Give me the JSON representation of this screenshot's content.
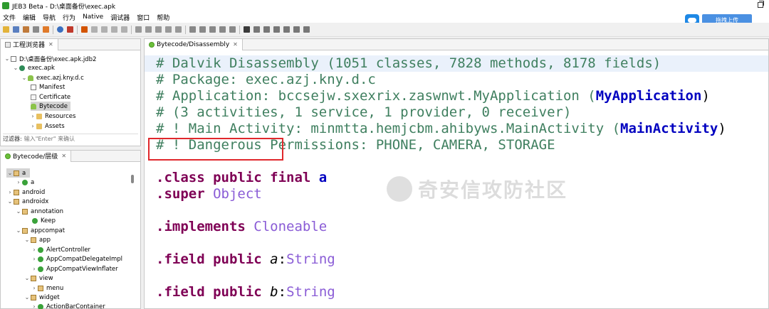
{
  "window": {
    "title": "JEB3 Beta - D:\\桌面备份\\exec.apk"
  },
  "menu": [
    "文件",
    "编辑",
    "导航",
    "行为",
    "Native",
    "调试器",
    "窗口",
    "帮助"
  ],
  "cloud": {
    "button_label": "拖拽上传",
    "icon": "baidu-cloud-icon",
    "accent": "#4a90e2"
  },
  "project_panel": {
    "tab_label": "工程浏览器",
    "tree": [
      {
        "label": "D:\\桌面备份\\exec.apk.jdb2",
        "icon": "database-icon"
      },
      {
        "label": "exec.apk",
        "icon": "apk-icon"
      },
      {
        "label": "exec.azj.kny.d.c",
        "icon": "android-icon"
      },
      {
        "label": "Manifest",
        "icon": "file-icon"
      },
      {
        "label": "Certificate",
        "icon": "certificate-icon"
      },
      {
        "label": "Bytecode",
        "icon": "bytecode-icon"
      },
      {
        "label": "Resources",
        "icon": "folder-icon"
      },
      {
        "label": "Assets",
        "icon": "folder-icon"
      }
    ],
    "filter_label": "过滤器:",
    "filter_placeholder": "输入\"Enter\" 来确认"
  },
  "hierarchy_panel": {
    "tab_label": "Bytecode/层级",
    "tree": [
      {
        "label": "a",
        "icon": "package-icon"
      },
      {
        "label": "a",
        "icon": "class-icon"
      },
      {
        "label": "android",
        "icon": "package-icon"
      },
      {
        "label": "androidx",
        "icon": "package-icon"
      },
      {
        "label": "annotation",
        "icon": "package-icon"
      },
      {
        "label": "Keep",
        "icon": "annotation-icon"
      },
      {
        "label": "appcompat",
        "icon": "package-icon"
      },
      {
        "label": "app",
        "icon": "package-icon"
      },
      {
        "label": "AlertController",
        "icon": "class-icon"
      },
      {
        "label": "AppCompatDelegateImpl",
        "icon": "class-icon"
      },
      {
        "label": "AppCompatViewInflater",
        "icon": "class-icon"
      },
      {
        "label": "view",
        "icon": "package-icon"
      },
      {
        "label": "menu",
        "icon": "package-icon"
      },
      {
        "label": "widget",
        "icon": "package-icon"
      },
      {
        "label": "ActionBarContainer",
        "icon": "class-icon"
      }
    ]
  },
  "editor": {
    "tab_label": "Bytecode/Disassembly",
    "lines": {
      "l1": "# Dalvik Disassembly (1051 classes, 7828 methods, 8178 fields)",
      "l2": "# Package: exec.azj.kny.d.c",
      "l3a": "# Application: bccsejw.sxexrix.zaswnwt.MyApplication (",
      "l3b": "MyApplication",
      "l3c": ")",
      "l4": "# (3 activities, 1 service, 1 provider, 0 receiver)",
      "l5a": "# ! Main Activity: minmtta.hemjcbm.ahibyws.MainActivity (",
      "l5b": "MainActivity",
      "l5c": ")",
      "l6": "# ! Dangerous Permissions: PHONE, CAMERA, STORAGE",
      "l7a": ".class public final ",
      "l7b": "a",
      "l8a": ".super ",
      "l8b": "Object",
      "l9a": ".implements ",
      "l9b": "Cloneable",
      "l10a": ".field public ",
      "l10b": "a",
      "l10c": ":",
      "l10d": "String",
      "l11a": ".field public ",
      "l11b": "b",
      "l11c": ":",
      "l11d": "String"
    }
  },
  "watermark": {
    "text": "奇安信攻防社区"
  },
  "colors": {
    "comment": "#3f7f5f",
    "keyword": "#7f0055",
    "type": "#8a5cd6",
    "highlight": "#e0282c"
  }
}
